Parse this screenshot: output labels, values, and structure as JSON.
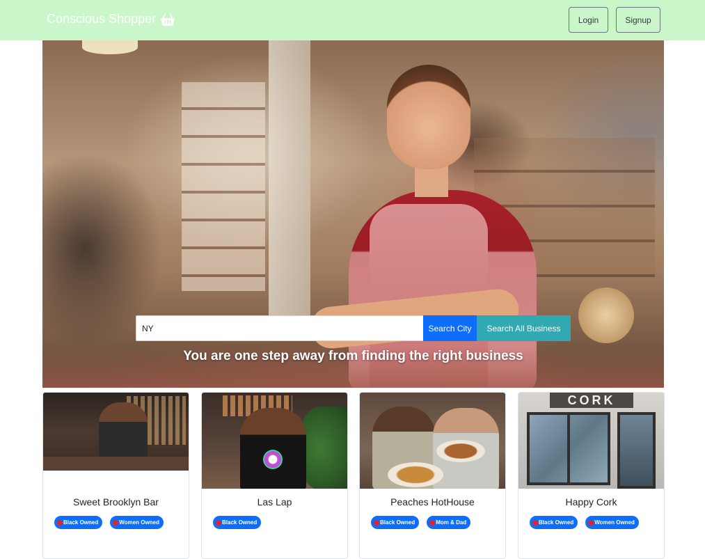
{
  "navbar": {
    "brand": "Conscious Shopper",
    "brand_icon": "basket-icon",
    "login_label": "Login",
    "signup_label": "Signup",
    "background_color": "#c9f7c9"
  },
  "hero": {
    "search_value": "NY",
    "search_city_label": "Search City",
    "search_all_label": "Search All Business",
    "tagline": "You are one step away from finding the right business"
  },
  "businesses": [
    {
      "name": "Sweet Brooklyn Bar",
      "tags": [
        "Black Owned",
        "Women Owned"
      ]
    },
    {
      "name": "Las Lap",
      "tags": [
        "Black Owned"
      ]
    },
    {
      "name": "Peaches HotHouse",
      "tags": [
        "Black Owned",
        "Mom & Dad"
      ]
    },
    {
      "name": "Happy Cork",
      "tags": [
        "Black Owned",
        "Women Owned"
      ]
    }
  ],
  "colors": {
    "primary": "#0d6efd",
    "accent_teal": "#31a9b3",
    "tag_dot": "#e0242c"
  }
}
